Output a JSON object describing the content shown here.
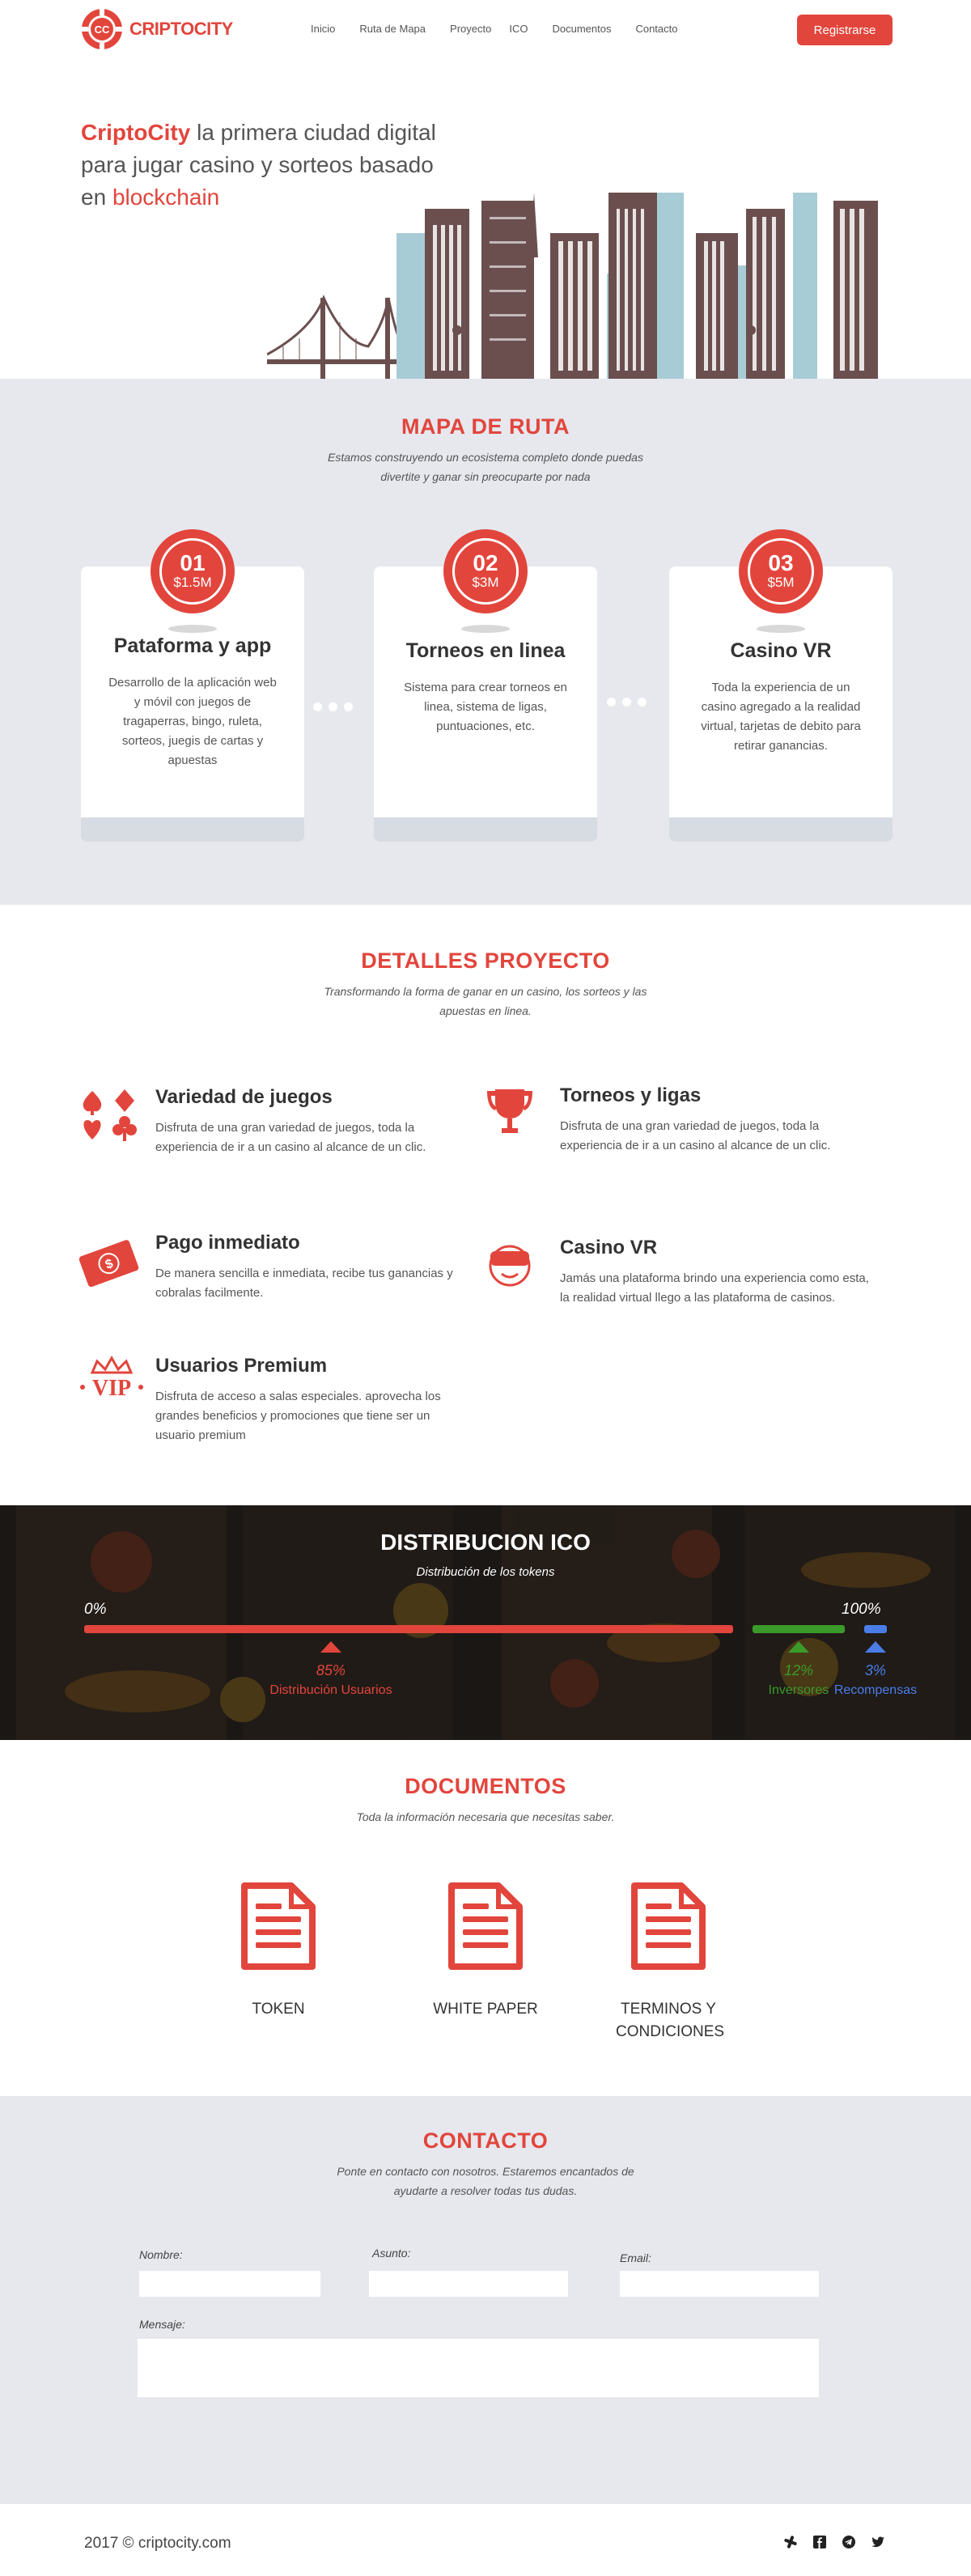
{
  "brand": {
    "name": "CRIPTOCITY"
  },
  "nav": {
    "items": [
      "Inicio",
      "Ruta de Mapa",
      "Proyecto",
      "ICO",
      "Documentos",
      "Contacto"
    ],
    "register": "Registrarse"
  },
  "hero": {
    "brand_word": "CriptoCity",
    "line": "la primera ciudad digital para jugar casino y sorteos basado en",
    "highlight": "blockchain"
  },
  "roadmap": {
    "title": "MAPA DE RUTA",
    "subtitle": "Estamos construyendo un ecosistema completo donde puedas divertite y ganar sin preocuparte por nada",
    "cards": [
      {
        "num": "01",
        "amount": "$1.5M",
        "title": "Pataforma  y app",
        "text": "Desarrollo de la aplicación web y móvil con juegos de tragaperras, bingo, ruleta, sorteos, juegis de cartas y apuestas"
      },
      {
        "num": "02",
        "amount": "$3M",
        "title": "Torneos en linea",
        "text": "Sistema para crear torneos en linea, sistema de ligas, puntuaciones, etc."
      },
      {
        "num": "03",
        "amount": "$5M",
        "title": "Casino VR",
        "text": "Toda la experiencia de un casino agregado a la realidad virtual, tarjetas de debito para retirar ganancias."
      }
    ]
  },
  "details": {
    "title": "DETALLES PROYECTO",
    "subtitle": "Transformando la forma de ganar en un casino, los sorteos y las apuestas en linea.",
    "features": [
      {
        "icon": "card-suits-icon",
        "title": "Variedad de juegos",
        "text": "Disfruta de una gran variedad de juegos, toda la experiencia de ir a un casino al alcance de un clic."
      },
      {
        "icon": "trophy-icon",
        "title": "Torneos y ligas",
        "text": "Disfruta de una gran variedad de juegos, toda la experiencia de ir a un casino al alcance de un clic."
      },
      {
        "icon": "money-icon",
        "title": "Pago inmediato",
        "text": "De manera sencilla e inmediata, recibe tus ganancias y cobralas facilmente."
      },
      {
        "icon": "vr-headset-icon",
        "title": "Casino VR",
        "text": "Jamás una plataforma brindo una experiencia como esta, la realidad virtual llego a las plataforma de casinos."
      },
      {
        "icon": "vip-crown-icon",
        "title": "Usuarios Premium",
        "text": "Disfruta de acceso a salas especiales. aprovecha los grandes beneficios y promociones que tiene ser un usuario premium"
      }
    ]
  },
  "ico": {
    "title": "DISTRIBUCION ICO",
    "subtitle": "Distribución de los tokens",
    "start": "0%",
    "end": "100%",
    "segments": [
      {
        "value": 85,
        "label_pct": "85%",
        "label": "Distribución Usuarios",
        "color": "#e2453c"
      },
      {
        "value": 12,
        "label_pct": "12%",
        "label": "Inversores",
        "color": "#3a9a2a"
      },
      {
        "value": 3,
        "label_pct": "3%",
        "label": "Recompensas",
        "color": "#4a7de8"
      }
    ]
  },
  "documents": {
    "title": "DOCUMENTOS",
    "subtitle": "Toda la información necesaria que necesitas saber.",
    "items": [
      "TOKEN",
      "WHITE PAPER",
      "TERMINOS Y CONDICIONES"
    ]
  },
  "contact": {
    "title": "CONTACTO",
    "subtitle": "Ponte en contacto con nosotros. Estaremos encantados de ayudarte a resolver todas tus dudas.",
    "fields": {
      "name": "Nombre:",
      "subject": "Asunto:",
      "email": "Email:",
      "message": "Mensaje:"
    }
  },
  "footer": {
    "copyright": "2017 ©  criptocity.com",
    "social": [
      "slack-icon",
      "facebook-icon",
      "telegram-icon",
      "twitter-icon"
    ]
  },
  "colors": {
    "accent": "#e2453c",
    "section_bg": "#e6e8ee"
  }
}
